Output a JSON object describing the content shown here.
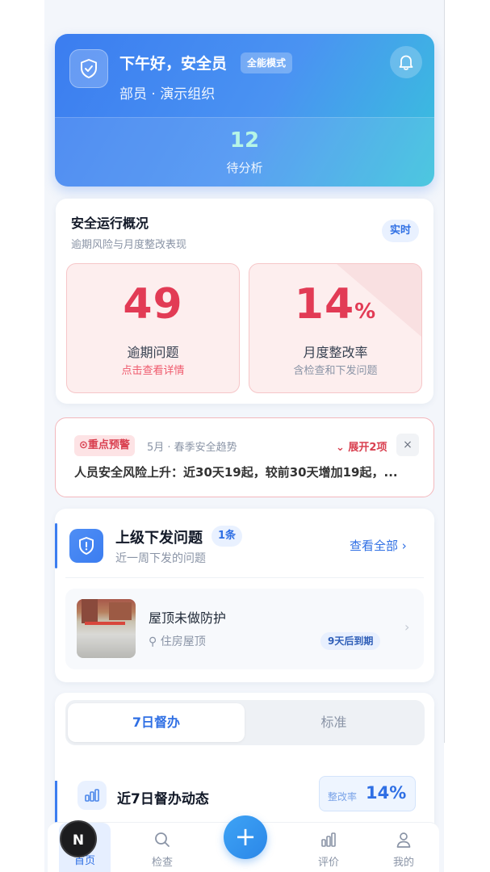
{
  "header": {
    "greeting": "下午好，安全员",
    "mode_badge": "全能模式",
    "org": "部员 · 演示组织",
    "pending_count": "12",
    "pending_label": "待分析"
  },
  "overview": {
    "title": "安全运行概况",
    "subtitle": "逾期风险与月度整改表现",
    "live_badge": "实时",
    "overdue": {
      "value": "49",
      "label": "逾期问题",
      "hint": "点击查看详情"
    },
    "rectify": {
      "value": "14",
      "unit": "%",
      "label": "月度整改率",
      "hint": "含检查和下发问题"
    }
  },
  "warning": {
    "tag": "重点预警",
    "meta": "5月 · 春季安全趋势",
    "expand": "展开2项",
    "close": "×",
    "text": "人员安全风险上升：近30天19起，较前30天增加19起，..."
  },
  "issues": {
    "title": "上级下发问题",
    "count": "1条",
    "subtitle": "近一周下发的问题",
    "view_all": "查看全部 ›",
    "item": {
      "name": "屋顶未做防护",
      "location": "住房屋顶",
      "due": "9天后到期"
    }
  },
  "supervision": {
    "tabs": [
      "7日督办",
      "标准"
    ],
    "title": "近7日督办动态",
    "rate_label": "整改率",
    "rate_value": "14%"
  },
  "nav": {
    "home": "首页",
    "check": "检查",
    "add": "+",
    "eval": "评价",
    "mine": "我的"
  },
  "overlay_badge": "N",
  "colors": {
    "brand": "#3b7df0",
    "danger": "#e23b55"
  }
}
